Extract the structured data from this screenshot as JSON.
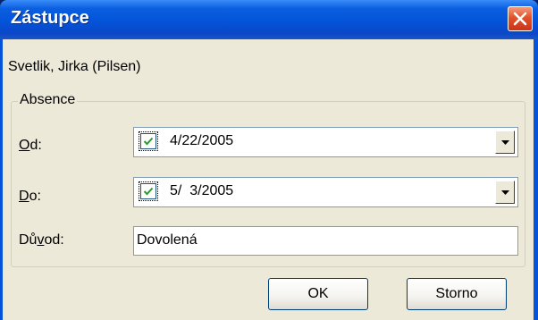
{
  "window": {
    "title": "Zástupce"
  },
  "user": {
    "name": "Svetlik, Jirka (Pilsen)"
  },
  "absence": {
    "group_label": "Absence",
    "from": {
      "label_u": "O",
      "label_rest": "d:",
      "value": "4/22/2005",
      "checked": true
    },
    "to": {
      "label_u": "D",
      "label_rest": "o:",
      "value": "5/  3/2005",
      "checked": true
    },
    "reason": {
      "label_pre": "Dů",
      "label_u": "v",
      "label_rest": "od:",
      "value": "Dovolená"
    }
  },
  "buttons": {
    "ok": "OK",
    "cancel": "Storno"
  },
  "icons": {
    "close": "close-icon",
    "check": "checkmark-icon",
    "dropdown": "chevron-down-icon"
  },
  "colors": {
    "titlebar": "#0453d8",
    "face": "#ece9d8",
    "close": "#e2522b"
  }
}
